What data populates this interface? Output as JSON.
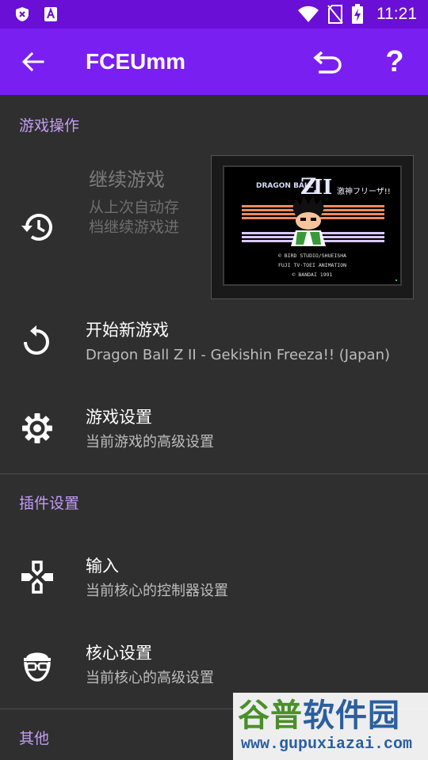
{
  "status_bar": {
    "time": "11:21",
    "left_icons": [
      "shield-x-icon",
      "font-a-icon"
    ],
    "right_icons": [
      "wifi-icon",
      "no-sim-icon",
      "battery-charging-icon"
    ]
  },
  "app_bar": {
    "title": "FCEUmm",
    "back_icon": "arrow-left-icon",
    "undo_icon": "undo-icon",
    "help_label": "?"
  },
  "sections": {
    "game_ops": {
      "title": "游戏操作",
      "resume": {
        "title": "继续游戏",
        "subtitle_line1": "从上次自动存",
        "subtitle_line2": "档继续游戏进"
      },
      "screenshot_text": {
        "logo_left": "DRAGON BALL",
        "logo_z": "Z",
        "logo_roman": "II",
        "logo_right": "激神フリーザ!!",
        "credit1": "© BIRD STUDIO/SHUEISHA",
        "credit2": "FUJI TV·TOEI ANIMATION",
        "credit3": "© BANDAI 1991"
      },
      "new_game": {
        "title": "开始新游戏",
        "subtitle": "Dragon Ball Z II - Gekishin Freeza!! (Japan)"
      },
      "game_settings": {
        "title": "游戏设置",
        "subtitle": "当前游戏的高级设置"
      }
    },
    "plugin_settings": {
      "title": "插件设置",
      "input": {
        "title": "输入",
        "subtitle": "当前核心的控制器设置"
      },
      "core_settings": {
        "title": "核心设置",
        "subtitle": "当前核心的高级设置"
      }
    },
    "other": {
      "title": "其他"
    }
  },
  "watermark": {
    "main_part1": "谷普",
    "main_part2": "软件园",
    "url": "www.gupuxiazai.com"
  },
  "colors": {
    "status_bar": "#6a0fd6",
    "app_bar": "#7a1ff2",
    "background": "#2f2f2f",
    "section_accent": "#c39cf7"
  }
}
